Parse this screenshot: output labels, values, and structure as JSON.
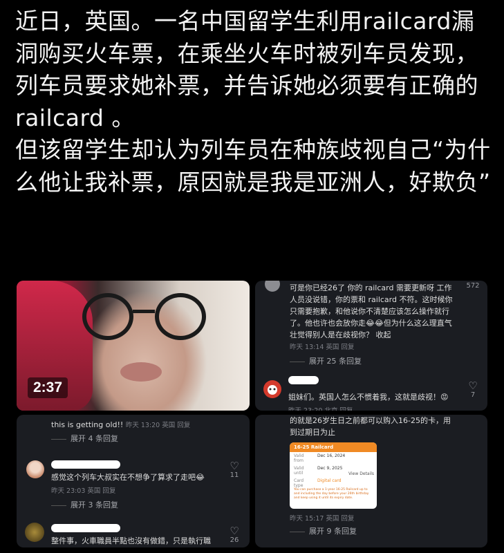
{
  "post": {
    "paragraphs": [
      "近日，英国。一名中国留学生利用railcard漏洞购买火车票，在乘坐火车时被列车员发现，列车员要求她补票，并告诉她必须要有正确的railcard 。",
      " 但该留学生却认为列车员在种族歧视自己“为什么他让我补票，原因就是我是亚洲人，好欺负”"
    ]
  },
  "video": {
    "duration": "2:37"
  },
  "panel2": {
    "comment1": "可是你已经26了 你的 railcard 需要更新呀 工作人员没说错，你的票和 railcard 不符。这时候你只需要抱歉，和他说你不清楚应该怎么操作就行了。他也许也会放你走😂😂但为什么这么理直气壮觉得别人是在歧视你？ 收起",
    "comment1_likes": "572",
    "comment1_meta": "昨天 13:14 英国 回复",
    "expand": "展开 25 条回复",
    "comment2": "姐妹们。英国人怎么不惯着我，这就是歧视！😡",
    "comment2_likes": "7",
    "comment2_meta": "昨天 23:20 北京 回复"
  },
  "panel3": {
    "top_text": "this is getting old!!",
    "top_meta": "昨天 13:20 英国 回复",
    "expand1": "展开 4 条回复",
    "comment": "感觉这个列车大叔实在不想争了算求了走吧😂",
    "comment_likes": "11",
    "comment_meta": "昨天 23:03 英国 回复",
    "expand2": "展开 3 条回复",
    "comment3": "整件事，火車職員半點也沒有做錯，只是執行職",
    "comment3_likes": "26"
  },
  "panel4": {
    "text": "的就是26岁生日之前都可以购入16-25的卡，用到过期日为止",
    "meta": "昨天 15:17 英国 回复",
    "expand": "展开 9 条回复",
    "card": {
      "title": "16-25 Railcard",
      "row1_label": "Valid from",
      "row1_value": "Dec 16, 2024",
      "row2_label": "Valid until",
      "row2_value": "Dec 9, 2025",
      "row3_label": "Card type",
      "row3_value": "Digital card",
      "view": "View Details",
      "note": "You can purchase a 1-year 16-25 Railcard up to and including the day before your 26th birthday and keep using it until its expiry date."
    }
  },
  "colors": {
    "accent": "#f08a24",
    "meta": "#7d7f86"
  }
}
